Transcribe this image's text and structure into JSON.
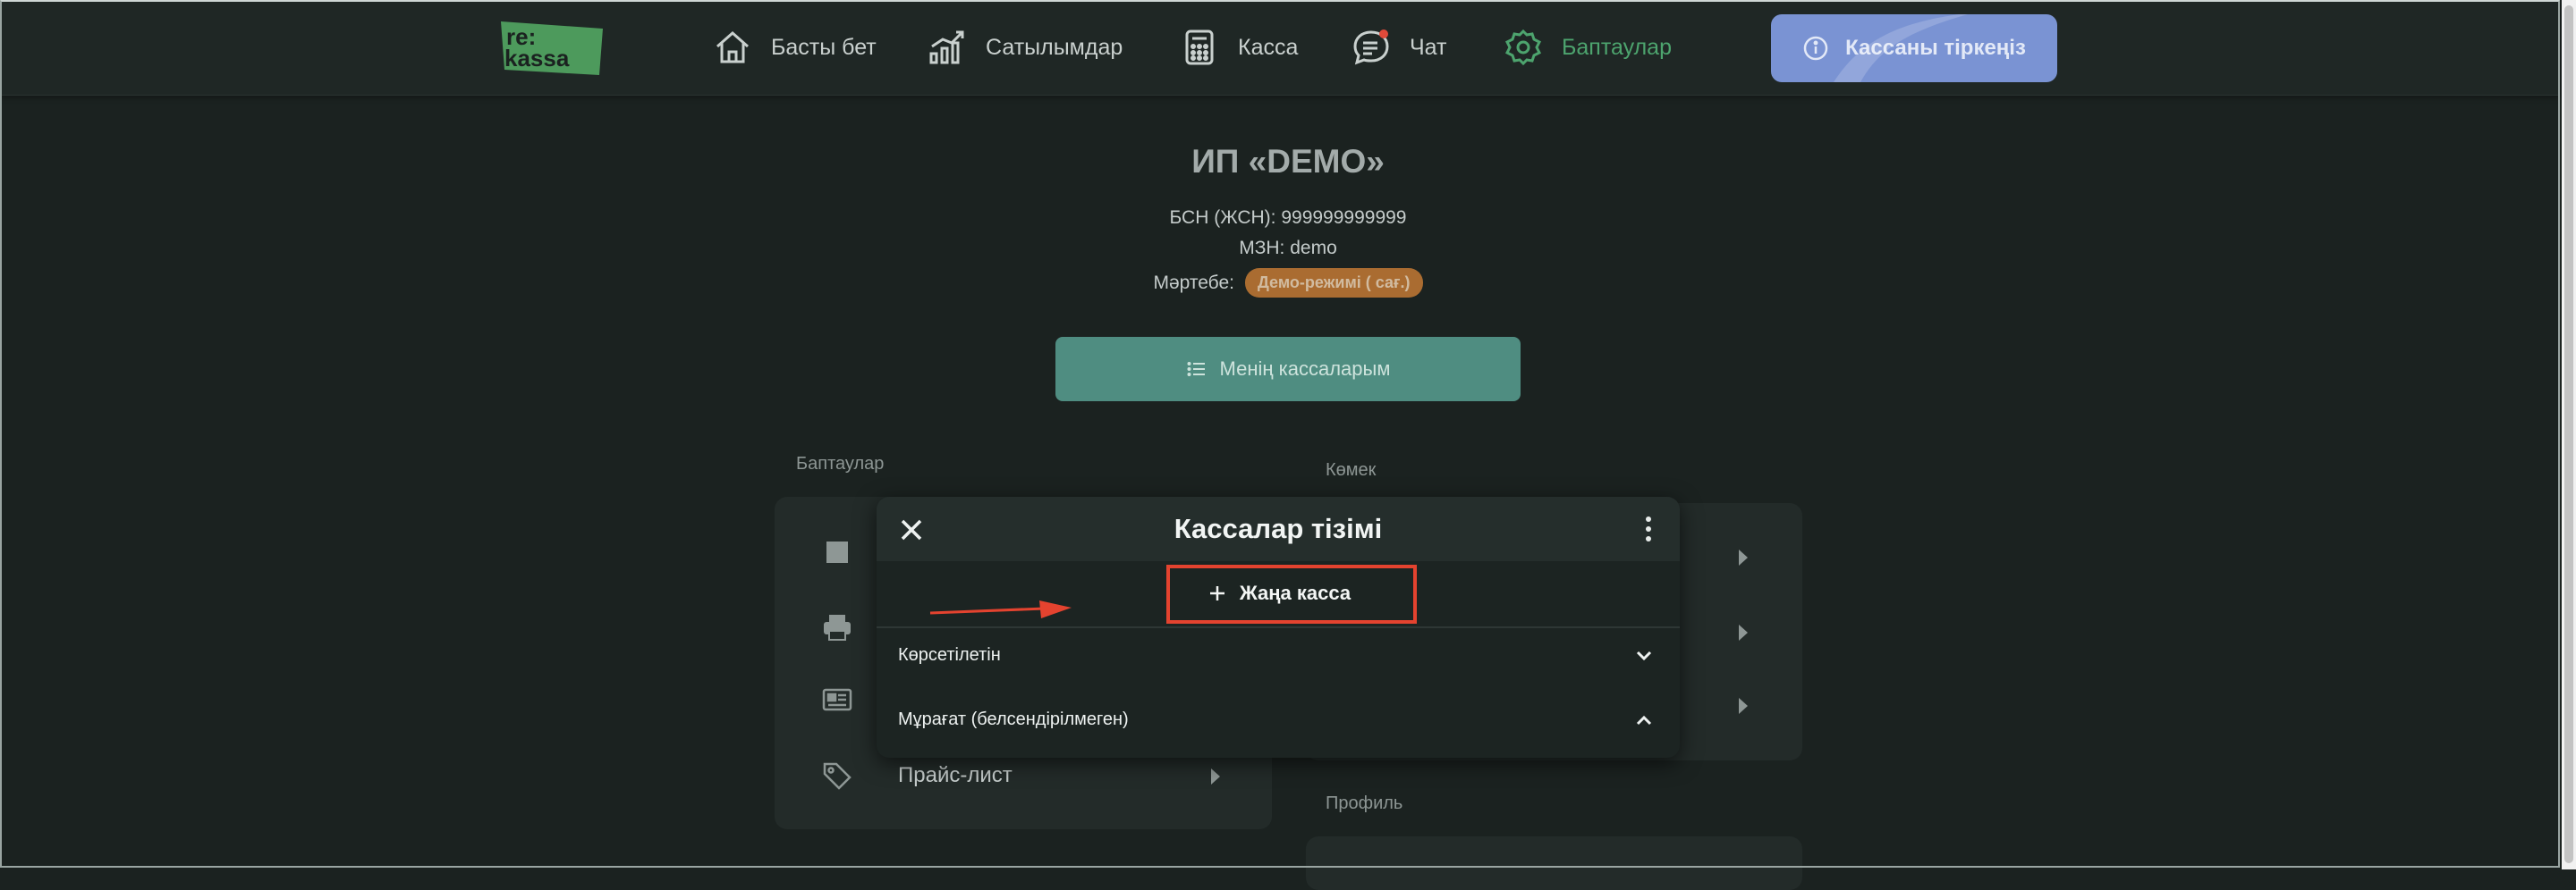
{
  "logo": {
    "line1": "re:",
    "line2": "kassa"
  },
  "nav": {
    "home": "Басты бет",
    "sales": "Сатылымдар",
    "kassa": "Касса",
    "chat": "Чат",
    "settings": "Баптаулар"
  },
  "register_button": "Кассаны тіркеңіз",
  "company": {
    "title": "ИП «DEMO»",
    "bin": "БСН (ЖСН): 999999999999",
    "mzn": "МЗН: demo",
    "status_label": "Мәртебе:",
    "status_badge": "Демо-режимі  ( сағ.)"
  },
  "my_kassas_button": "Менің кассаларым",
  "settings_section": {
    "label": "Баптаулар",
    "price_list": "Прайс-лист"
  },
  "help_section": {
    "label": "Көмек"
  },
  "profile_section": {
    "label": "Профиль"
  },
  "modal": {
    "title": "Кассалар тізімі",
    "new_kassa": "Жаңа касса",
    "visible": "Көрсетілетін",
    "archive": "Мұрағат (белсендірілмеген)"
  },
  "colors": {
    "accent_green": "#4da46e",
    "button_teal": "#4f8d81",
    "register_blue": "#7a93d3",
    "badge_orange": "#c47a34",
    "highlight_red": "#e4432f"
  }
}
